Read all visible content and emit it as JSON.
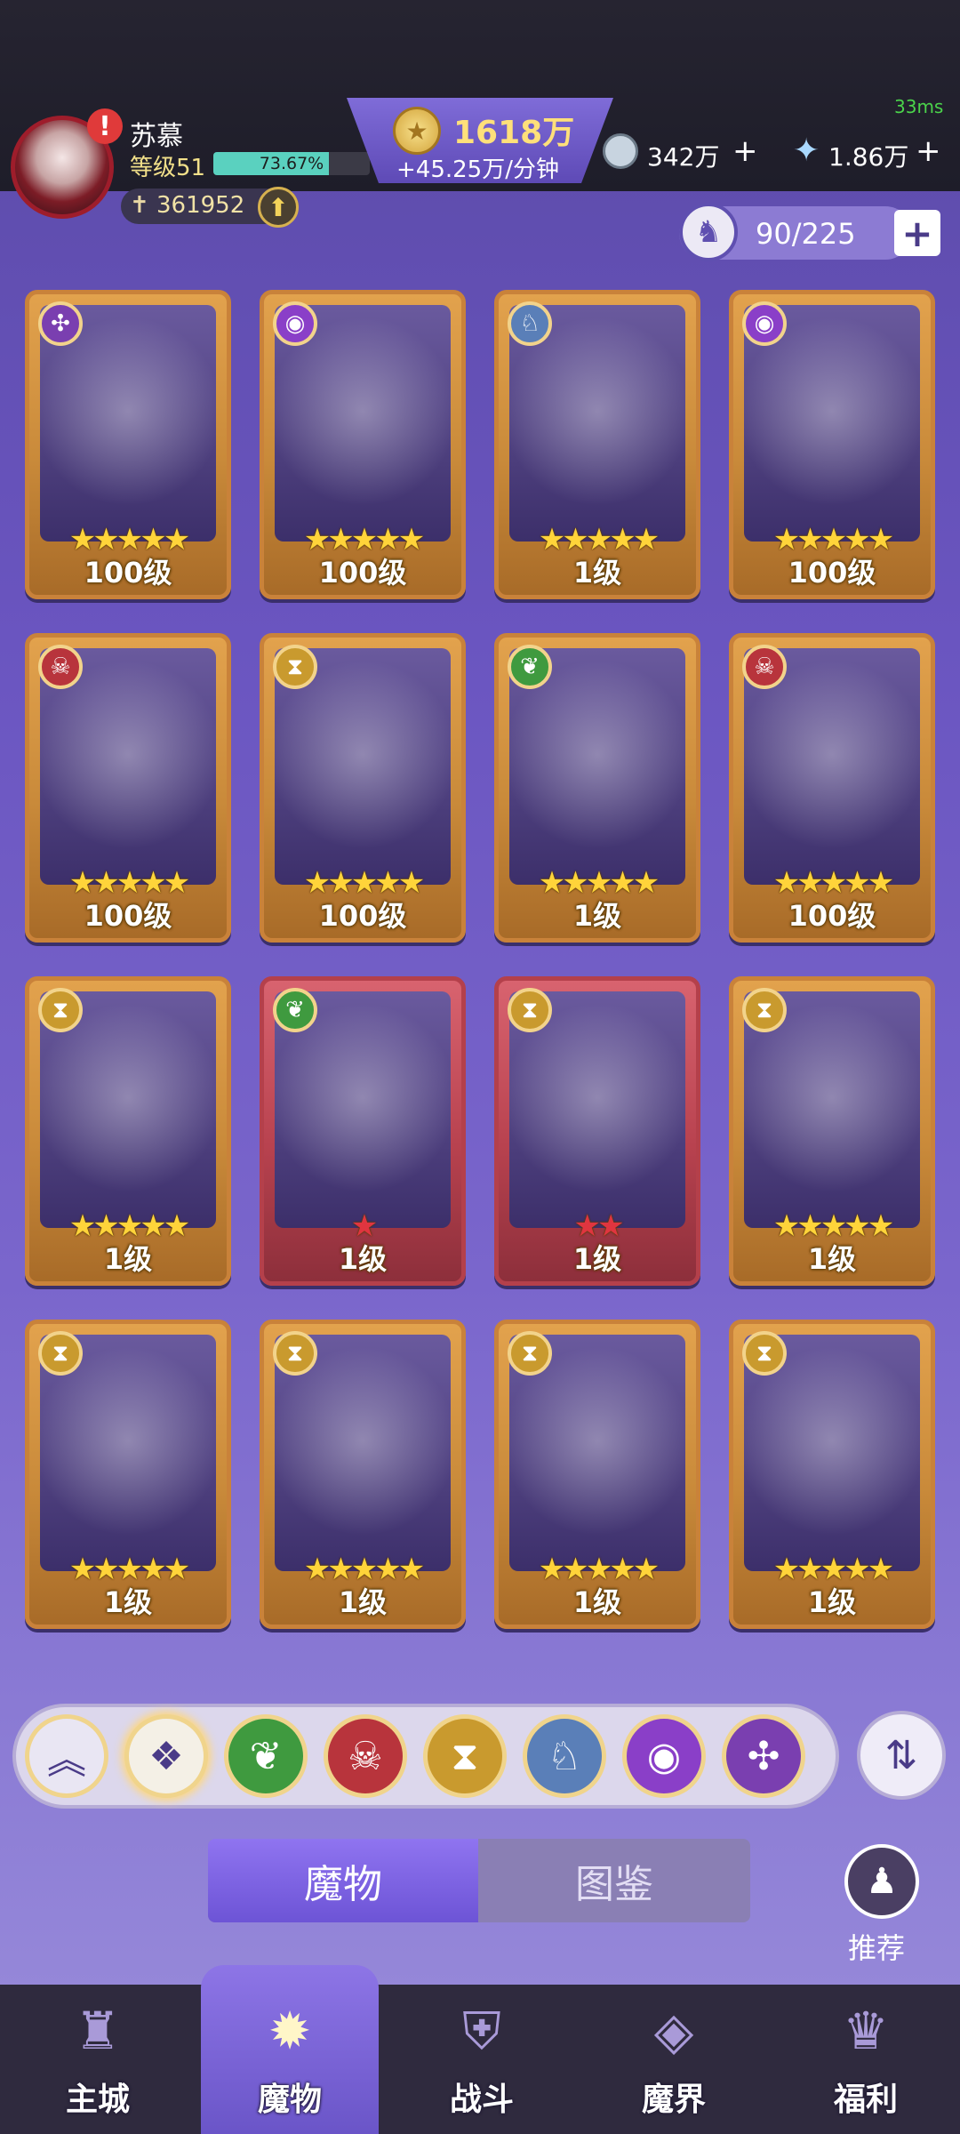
{
  "header": {
    "player_name": "苏慕",
    "level_label": "等级51",
    "level_progress_pct": 73.67,
    "level_progress_text": "73.67%",
    "power_value": "361952",
    "gold_amount": "1618万",
    "gold_rate": "+45.25万/分钟",
    "latency": "33ms",
    "resource1_value": "342万",
    "resource2_value": "1.86万",
    "plus_symbol": "+"
  },
  "capacity": {
    "value": "90/225",
    "add_label": "+"
  },
  "cards": [
    {
      "level": "100级",
      "stars": "★★★★★",
      "element_icon": "pinwheel-icon",
      "element_color": "#7a3fb0"
    },
    {
      "level": "100级",
      "stars": "★★★★★",
      "element_icon": "eye-icon",
      "element_color": "#8a3fc8"
    },
    {
      "level": "1级",
      "stars": "★★★★★",
      "element_icon": "dragon-icon",
      "element_color": "#5a7fb8"
    },
    {
      "level": "100级",
      "stars": "★★★★★",
      "element_icon": "eye-icon",
      "element_color": "#8a3fc8"
    },
    {
      "level": "100级",
      "stars": "★★★★★",
      "element_icon": "demon-icon",
      "element_color": "#b8343c"
    },
    {
      "level": "100级",
      "stars": "★★★★★",
      "element_icon": "hourglass-icon",
      "element_color": "#c99a2e"
    },
    {
      "level": "1级",
      "stars": "★★★★★",
      "element_icon": "leaf-icon",
      "element_color": "#3f9a3f"
    },
    {
      "level": "100级",
      "stars": "★★★★★",
      "element_icon": "demon-icon",
      "element_color": "#b8343c"
    },
    {
      "level": "1级",
      "stars": "★★★★★",
      "element_icon": "hourglass-icon",
      "element_color": "#c99a2e"
    },
    {
      "level": "1级",
      "stars": "★",
      "element_icon": "leaf-icon",
      "element_color": "#3f9a3f",
      "frame": "red"
    },
    {
      "level": "1级",
      "stars": "★★",
      "element_icon": "hourglass-icon",
      "element_color": "#c99a2e",
      "frame": "red"
    },
    {
      "level": "1级",
      "stars": "★★★★★",
      "element_icon": "hourglass-icon",
      "element_color": "#c99a2e"
    },
    {
      "level": "1级",
      "stars": "★★★★★",
      "element_icon": "hourglass-icon",
      "element_color": "#c99a2e"
    },
    {
      "level": "1级",
      "stars": "★★★★★",
      "element_icon": "hourglass-icon",
      "element_color": "#c99a2e"
    },
    {
      "level": "1级",
      "stars": "★★★★★",
      "element_icon": "hourglass-icon",
      "element_color": "#c99a2e"
    },
    {
      "level": "1级",
      "stars": "★★★★★",
      "element_icon": "hourglass-icon",
      "element_color": "#c99a2e"
    }
  ],
  "filters": [
    {
      "icon": "collapse-up-icon",
      "color": "#e9e6f3"
    },
    {
      "icon": "all-diamond-icon",
      "color": "#f4f0e6",
      "selected": true
    },
    {
      "icon": "leaf-icon",
      "color": "#3f9a3f"
    },
    {
      "icon": "demon-icon",
      "color": "#b8343c"
    },
    {
      "icon": "hourglass-icon",
      "color": "#c99a2e"
    },
    {
      "icon": "dragon-icon",
      "color": "#5a7fb8"
    },
    {
      "icon": "eye-icon",
      "color": "#8a3fc8"
    },
    {
      "icon": "pinwheel-icon",
      "color": "#7a3fb0"
    }
  ],
  "tabs": {
    "monster": "魔物",
    "codex": "图鉴"
  },
  "recommend": {
    "label": "推荐"
  },
  "nav": [
    {
      "label": "主城",
      "icon": "castle-icon"
    },
    {
      "label": "魔物",
      "icon": "flame-icon",
      "active": true
    },
    {
      "label": "战斗",
      "icon": "shield-sword-icon"
    },
    {
      "label": "魔界",
      "icon": "portal-icon"
    },
    {
      "label": "福利",
      "icon": "treasure-chest-icon"
    }
  ]
}
